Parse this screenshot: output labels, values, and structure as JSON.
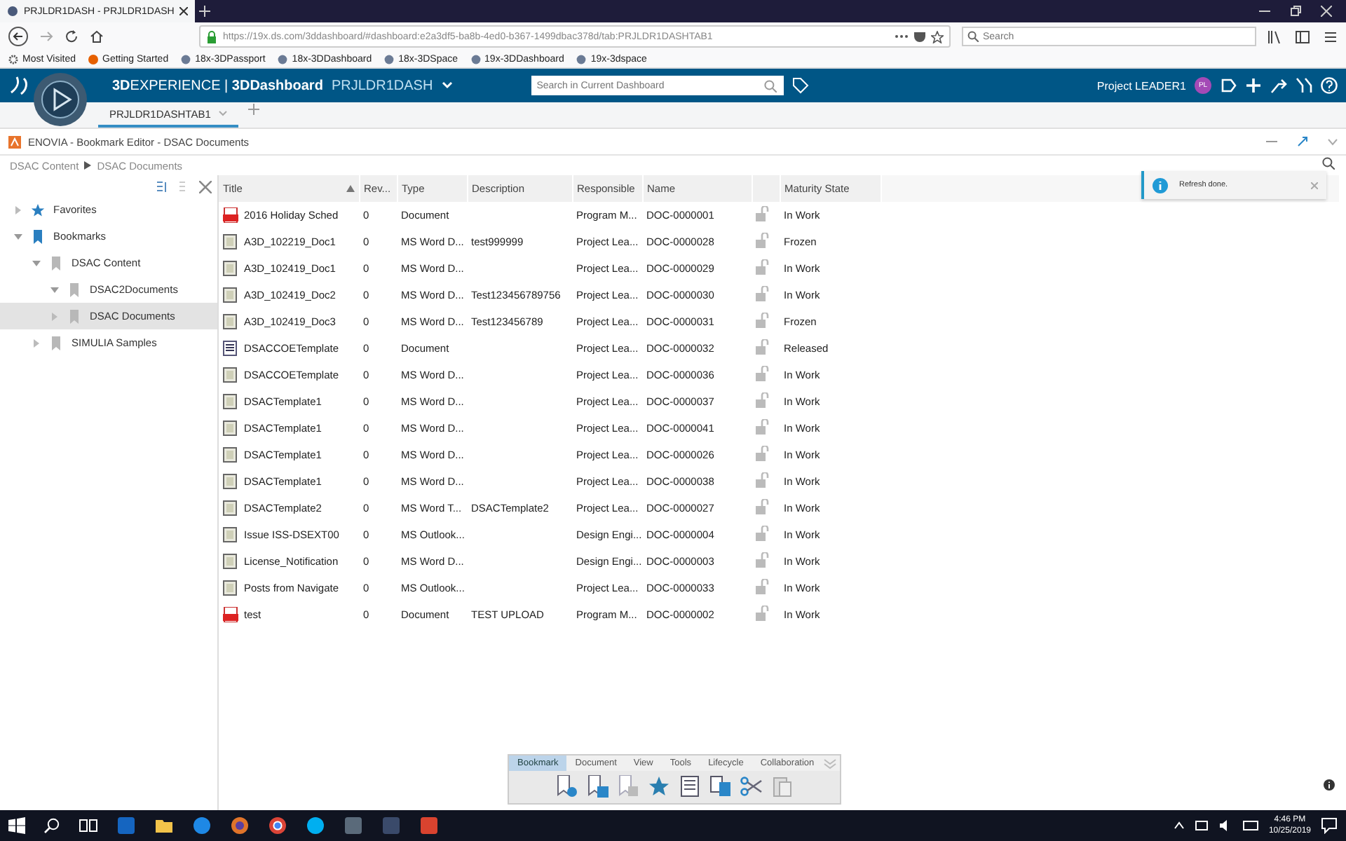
{
  "browser": {
    "tab_title": "PRJLDR1DASH - PRJLDR1DASH",
    "url": "https://19x.ds.com/3ddashboard/#dashboard:e2a3df5-ba8b-4ed0-b367-1499dbac378d/tab:PRJLDR1DASHTAB1",
    "search": {
      "placeholder": "Search"
    },
    "bookmarks": [
      "Most Visited",
      "Getting Started",
      "18x-3DPassport",
      "18x-3DDashboard",
      "18x-3DSpace",
      "19x-3DDashboard",
      "19x-3dspace"
    ]
  },
  "app": {
    "brand": "**3D**EXPERIENCE | **3DDashboard**",
    "dashboard": "PRJLDR1DASH",
    "search": {
      "placeholder": "Search in Current Dashboard"
    },
    "user": "Project LEADER1",
    "avatar": "PL",
    "tabs": [
      {
        "label": "PRJLDR1DASHTAB1",
        "selected": true
      }
    ]
  },
  "widget": {
    "title": "ENOVIA - Bookmark Editor - DSAC Documents",
    "breadcrumb": [
      "DSAC Content",
      "DSAC Documents"
    ]
  },
  "tree": [
    {
      "label": "Favorites",
      "kind": "star",
      "expanded": false,
      "selected": false
    },
    {
      "label": "Bookmarks",
      "kind": "bookmark",
      "expanded": true,
      "selected": false,
      "children": [
        {
          "label": "DSAC Content",
          "kind": "folder",
          "expanded": true,
          "selected": false,
          "children": [
            {
              "label": "DSAC2Documents",
              "kind": "folder",
              "expanded": true,
              "selected": false
            },
            {
              "label": "DSAC Documents",
              "kind": "folder",
              "expanded": false,
              "selected": true
            }
          ]
        },
        {
          "label": "SIMULIA Samples",
          "kind": "folder",
          "expanded": false,
          "selected": false
        }
      ]
    }
  ],
  "table": {
    "columns": [
      "Title",
      "Rev...",
      "Type",
      "Description",
      "Responsible",
      "Name",
      "",
      "Maturity State"
    ],
    "rows": [
      {
        "kind": "pdf",
        "title": "2016 Holiday Sched",
        "rev": "0",
        "type": "Document",
        "description": "",
        "responsible": "Program M...",
        "name": "DOC-0000001",
        "state": "In Work"
      },
      {
        "kind": "word",
        "title": "A3D_102219_Doc1",
        "rev": "0",
        "type": "MS Word D...",
        "description": "test999999",
        "responsible": "Project Lea...",
        "name": "DOC-0000028",
        "state": "Frozen"
      },
      {
        "kind": "word",
        "title": "A3D_102419_Doc1",
        "rev": "0",
        "type": "MS Word D...",
        "description": "",
        "responsible": "Project Lea...",
        "name": "DOC-0000029",
        "state": "In Work"
      },
      {
        "kind": "word",
        "title": "A3D_102419_Doc2",
        "rev": "0",
        "type": "MS Word D...",
        "description": "Test123456789756",
        "responsible": "Project Lea...",
        "name": "DOC-0000030",
        "state": "In Work"
      },
      {
        "kind": "word",
        "title": "A3D_102419_Doc3",
        "rev": "0",
        "type": "MS Word D...",
        "description": "Test123456789",
        "responsible": "Project Lea...",
        "name": "DOC-0000031",
        "state": "Frozen"
      },
      {
        "kind": "doc",
        "title": "DSACCOETemplate",
        "rev": "0",
        "type": "Document",
        "description": "",
        "responsible": "Project Lea...",
        "name": "DOC-0000032",
        "state": "Released"
      },
      {
        "kind": "word",
        "title": "DSACCOETemplate",
        "rev": "0",
        "type": "MS Word D...",
        "description": "",
        "responsible": "Project Lea...",
        "name": "DOC-0000036",
        "state": "In Work"
      },
      {
        "kind": "word",
        "title": "DSACTemplate1",
        "rev": "0",
        "type": "MS Word D...",
        "description": "",
        "responsible": "Project Lea...",
        "name": "DOC-0000037",
        "state": "In Work"
      },
      {
        "kind": "word",
        "title": "DSACTemplate1",
        "rev": "0",
        "type": "MS Word D...",
        "description": "",
        "responsible": "Project Lea...",
        "name": "DOC-0000041",
        "state": "In Work"
      },
      {
        "kind": "word",
        "title": "DSACTemplate1",
        "rev": "0",
        "type": "MS Word D...",
        "description": "",
        "responsible": "Project Lea...",
        "name": "DOC-0000026",
        "state": "In Work"
      },
      {
        "kind": "word",
        "title": "DSACTemplate1",
        "rev": "0",
        "type": "MS Word D...",
        "description": "",
        "responsible": "Project Lea...",
        "name": "DOC-0000038",
        "state": "In Work"
      },
      {
        "kind": "word",
        "title": "DSACTemplate2",
        "rev": "0",
        "type": "MS Word T...",
        "description": "DSACTemplate2",
        "responsible": "Project Lea...",
        "name": "DOC-0000027",
        "state": "In Work"
      },
      {
        "kind": "word",
        "title": "Issue ISS-DSEXT00",
        "rev": "0",
        "type": "MS Outlook...",
        "description": "",
        "responsible": "Design Engi...",
        "name": "DOC-0000004",
        "state": "In Work"
      },
      {
        "kind": "word",
        "title": "License_Notification",
        "rev": "0",
        "type": "MS Word D...",
        "description": "",
        "responsible": "Design Engi...",
        "name": "DOC-0000003",
        "state": "In Work"
      },
      {
        "kind": "word",
        "title": "Posts from Navigate",
        "rev": "0",
        "type": "MS Outlook...",
        "description": "",
        "responsible": "Project Lea...",
        "name": "DOC-0000033",
        "state": "In Work"
      },
      {
        "kind": "pdf",
        "title": "test",
        "rev": "0",
        "type": "Document",
        "description": "TEST UPLOAD",
        "responsible": "Program M...",
        "name": "DOC-0000002",
        "state": "In Work"
      }
    ]
  },
  "toast": {
    "message": "Refresh done."
  },
  "toolbar": {
    "tabs": [
      {
        "label": "Bookmark",
        "selected": true
      },
      {
        "label": "Document",
        "selected": false
      },
      {
        "label": "View",
        "selected": false
      },
      {
        "label": "Tools",
        "selected": false
      },
      {
        "label": "Lifecycle",
        "selected": false
      },
      {
        "label": "Collaboration",
        "selected": false
      }
    ]
  },
  "taskbar": {
    "time": "4:46 PM",
    "date": "10/25/2019"
  }
}
